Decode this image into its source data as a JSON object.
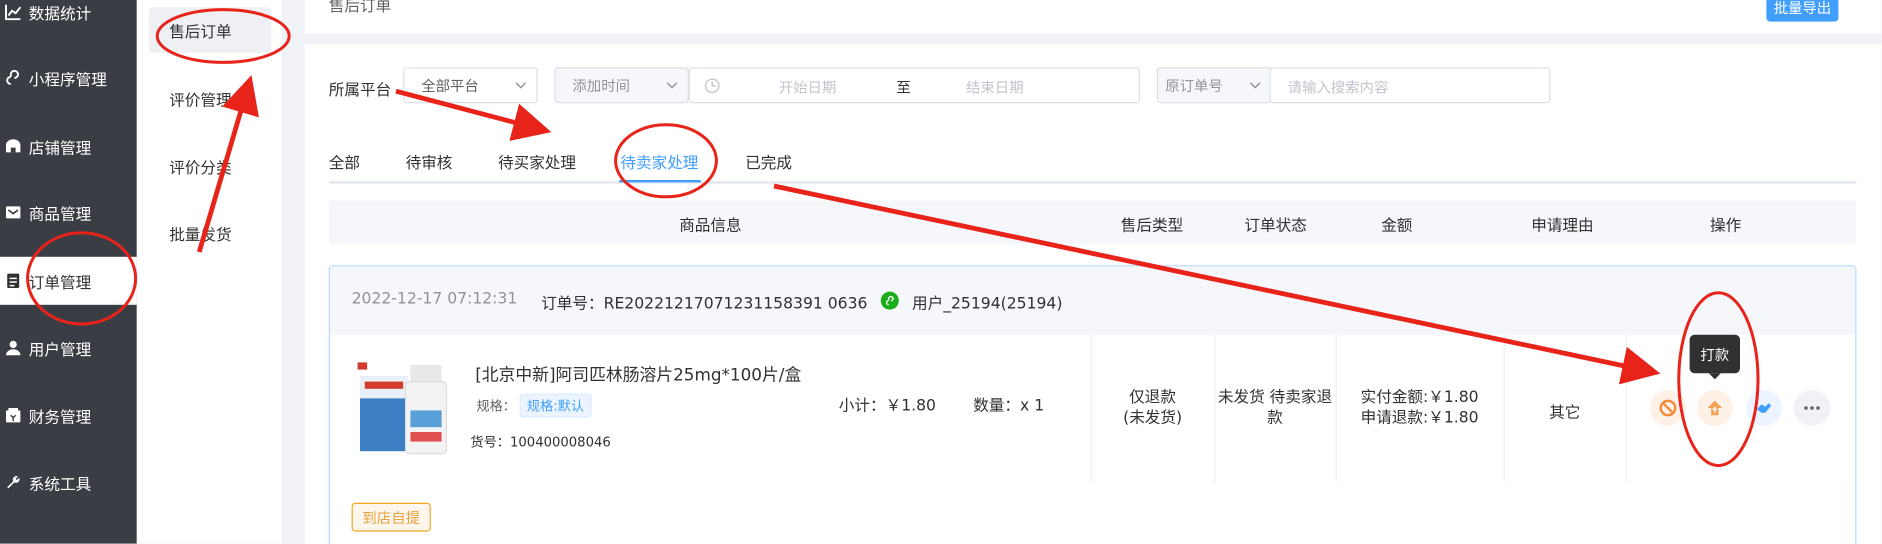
{
  "sidebar": {
    "items": [
      {
        "label": "数据统计",
        "icon": "chart-icon"
      },
      {
        "label": "小程序管理",
        "icon": "mini-program-icon"
      },
      {
        "label": "店铺管理",
        "icon": "store-icon"
      },
      {
        "label": "商品管理",
        "icon": "goods-icon"
      },
      {
        "label": "订单管理",
        "icon": "order-icon"
      },
      {
        "label": "用户管理",
        "icon": "user-icon"
      },
      {
        "label": "财务管理",
        "icon": "finance-icon"
      },
      {
        "label": "系统工具",
        "icon": "wrench-icon"
      }
    ]
  },
  "submenu": {
    "items": [
      {
        "label": "售后订单"
      },
      {
        "label": "评价管理"
      },
      {
        "label": "评价分类"
      },
      {
        "label": "批量发货"
      }
    ]
  },
  "header": {
    "title": "售后订单",
    "export_label": "批量导出"
  },
  "filters": {
    "platform_label": "所属平台",
    "platform_value": "全部平台",
    "time_type": "添加时间",
    "start_placeholder": "开始日期",
    "range_sep": "至",
    "end_placeholder": "结束日期",
    "order_no_type": "原订单号",
    "search_placeholder": "请输入搜索内容"
  },
  "tabs": [
    {
      "label": "全部"
    },
    {
      "label": "待审核"
    },
    {
      "label": "待买家处理"
    },
    {
      "label": "待卖家处理"
    },
    {
      "label": "已完成"
    }
  ],
  "table": {
    "columns": [
      "商品信息",
      "售后类型",
      "订单状态",
      "金额",
      "申请理由",
      "操作"
    ]
  },
  "order": {
    "datetime": "2022-12-17 07:12:31",
    "order_no": "订单号：RE20221217071231158391 0636",
    "user": "用户_25194(25194)",
    "product_name": "[北京中新]阿司匹林肠溶片25mg*100片/盒",
    "spec_label": "规格：",
    "spec_value": "规格:默认",
    "sku": "货号：100400008046",
    "subtotal": "小计：￥1.80",
    "quantity": "数量：x 1",
    "aftersale_type_line1": "仅退款",
    "aftersale_type_line2": "(未发货)",
    "status_line1": "未发货 待卖家退",
    "status_line2": "款",
    "paid": "实付金额:￥1.80",
    "refund": "申请退款:￥1.80",
    "reason": "其它",
    "tooltip": "打款",
    "pickup": "到店自提"
  },
  "colors": {
    "primary": "#409eff",
    "annotation": "#e8231a",
    "refund_orange": "#f5a050",
    "wechat_green": "#1aad19",
    "sidebar_bg": "#3a3d44"
  }
}
